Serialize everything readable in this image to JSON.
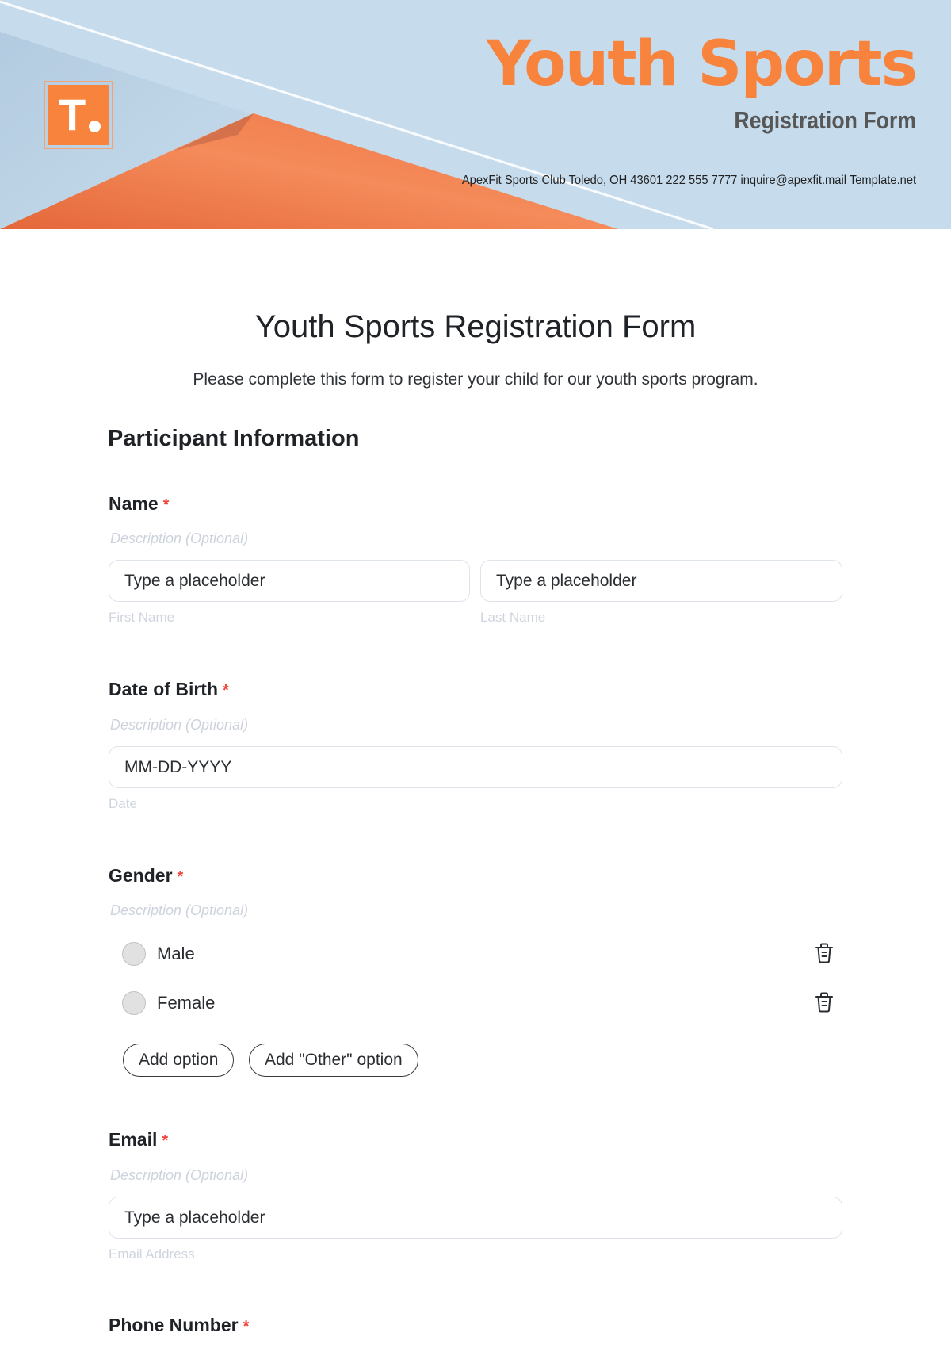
{
  "header": {
    "logo_letter": "T",
    "title": "Youth Sports",
    "subtitle": "Registration Form",
    "contact": "ApexFit Sports Club Toledo, OH 43601 222 555 7777 inquire@apexfit.mail Template.net",
    "colors": {
      "accent": "#f7833d",
      "sky": "#c5dced"
    }
  },
  "form": {
    "title": "Youth Sports Registration Form",
    "description": "Please complete this form to register your child for our youth sports program.",
    "section": "Participant Information",
    "required_mark": "*",
    "description_placeholder": "Description (Optional)",
    "fields": {
      "name": {
        "label": "Name",
        "first": {
          "placeholder": "Type a placeholder",
          "sublabel": "First Name"
        },
        "last": {
          "placeholder": "Type a placeholder",
          "sublabel": "Last Name"
        }
      },
      "dob": {
        "label": "Date of Birth",
        "placeholder": "MM-DD-YYYY",
        "sublabel": "Date"
      },
      "gender": {
        "label": "Gender",
        "options": [
          "Male",
          "Female"
        ],
        "add_option": "Add option",
        "add_other_option": "Add \"Other\" option"
      },
      "email": {
        "label": "Email",
        "placeholder": "Type a placeholder",
        "sublabel": "Email Address"
      },
      "phone": {
        "label": "Phone Number"
      }
    }
  }
}
